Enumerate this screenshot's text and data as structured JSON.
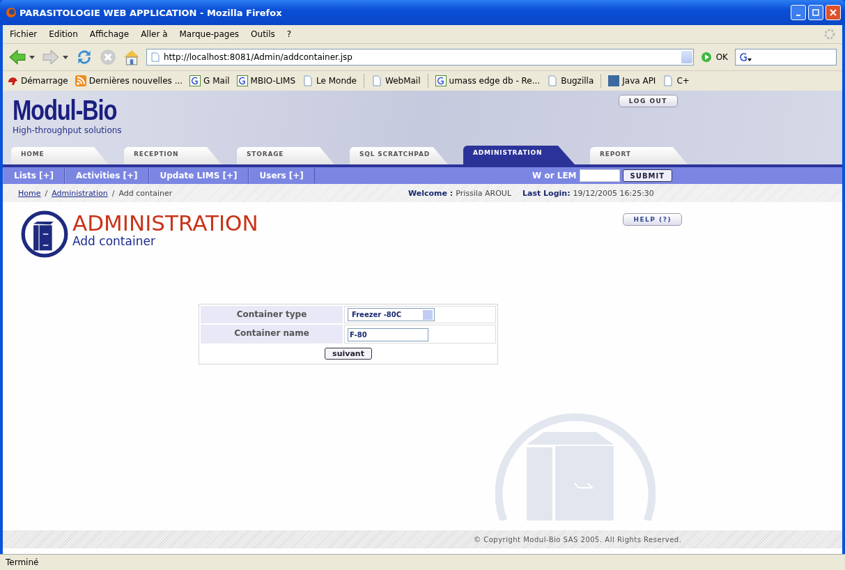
{
  "window": {
    "title": "PARASITOLOGIE WEB APPLICATION - Mozilla Firefox"
  },
  "menu": [
    "Fichier",
    "Edition",
    "Affichage",
    "Aller à",
    "Marque-pages",
    "Outils",
    "?"
  ],
  "address": {
    "value": "http://localhost:8081/Admin/addcontainer.jsp",
    "go": "OK"
  },
  "bookmarks": [
    {
      "label": "Démarrage",
      "kind": "animal"
    },
    {
      "label": "Dernières nouvelles ...",
      "kind": "feed"
    },
    {
      "label": "G Mail",
      "kind": "google"
    },
    {
      "label": "MBIO-LIMS",
      "kind": "google"
    },
    {
      "label": "Le Monde",
      "kind": "page"
    },
    {
      "label": "WebMail",
      "kind": "page"
    },
    {
      "label": "umass edge db - Re...",
      "kind": "google"
    },
    {
      "label": "Bugzilla",
      "kind": "page"
    },
    {
      "label": "Java API",
      "kind": "sun"
    },
    {
      "label": "C+",
      "kind": "page"
    }
  ],
  "header": {
    "logo": "Modul-Bio",
    "tagline": "High-throughput solutions",
    "logout": "LOG OUT"
  },
  "tabs": [
    {
      "label": "HOME",
      "selected": false
    },
    {
      "label": "RECEPTION",
      "selected": false
    },
    {
      "label": "STORAGE",
      "selected": false
    },
    {
      "label": "SQL SCRATCHPAD",
      "selected": false
    },
    {
      "label": "ADMINISTRATION",
      "selected": true
    },
    {
      "label": "REPORT",
      "selected": false
    }
  ],
  "subnav": [
    "Lists [+]",
    "Activities [+]",
    "Update LIMS [+]",
    "Users [+]"
  ],
  "lookup": {
    "label": "W or LEM",
    "button": "SUBMIT"
  },
  "breadcrumb": [
    {
      "label": "Home",
      "kind": "link"
    },
    {
      "label": "/",
      "kind": "separator"
    },
    {
      "label": "Administration",
      "kind": "link"
    },
    {
      "label": "/",
      "kind": "separator"
    },
    {
      "label": "Add container",
      "kind": "current"
    }
  ],
  "user": {
    "welcome_label": "Welcome :",
    "name": "Prissila AROUL",
    "last_login_label": "Last Login:",
    "last_login": "19/12/2005 16:25:30"
  },
  "page": {
    "title": "ADMINISTRATION",
    "subtitle": "Add container",
    "help": "HELP (?)"
  },
  "form": {
    "type_label": "Container type",
    "type_value": "Freezer -80C",
    "name_label": "Container name",
    "name_value": "F-80",
    "submit": "suivant"
  },
  "footer": "© Copyright Modul-Bio SAS 2005. All Rights Reserved.",
  "status_bar": "Terminé"
}
